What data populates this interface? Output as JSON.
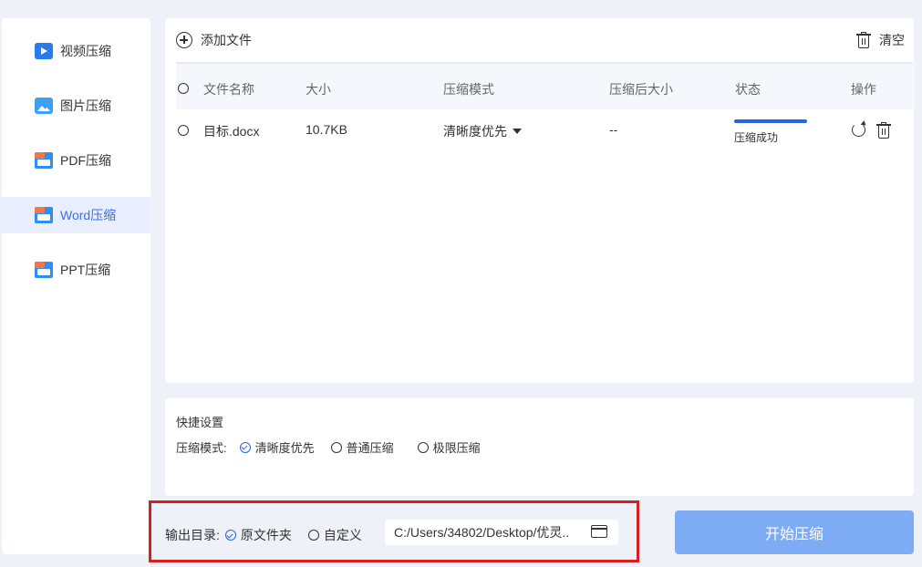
{
  "sidebar": {
    "items": [
      {
        "label": "视频压缩",
        "icon": "video-icon"
      },
      {
        "label": "图片压缩",
        "icon": "image-icon"
      },
      {
        "label": "PDF压缩",
        "icon": "pdf-icon"
      },
      {
        "label": "Word压缩",
        "icon": "word-icon",
        "active": true
      },
      {
        "label": "PPT压缩",
        "icon": "ppt-icon"
      }
    ]
  },
  "toolbar": {
    "add_label": "添加文件",
    "clear_label": "清空"
  },
  "table": {
    "headers": [
      "文件名称",
      "大小",
      "压缩模式",
      "压缩后大小",
      "状态",
      "操作"
    ],
    "rows": [
      {
        "name": "目标.docx",
        "size": "10.7KB",
        "mode": "清晰度优先",
        "compressed_size": "--",
        "status": "压缩成功",
        "progress": 1.0
      }
    ]
  },
  "quick_settings": {
    "title": "快捷设置",
    "mode_label": "压缩模式:",
    "options": [
      "清晰度优先",
      "普通压缩",
      "极限压缩"
    ],
    "selected": "清晰度优先"
  },
  "output": {
    "label": "输出目录:",
    "options": [
      "原文件夹",
      "自定义"
    ],
    "selected": "原文件夹",
    "path": "C:/Users/34802/Desktop/优灵.."
  },
  "start_button": "开始压缩",
  "colors": {
    "accent": "#2a64e0",
    "active_bg": "#e9efff",
    "start_button": "#7eacf4",
    "highlight_border": "#d4201e"
  }
}
